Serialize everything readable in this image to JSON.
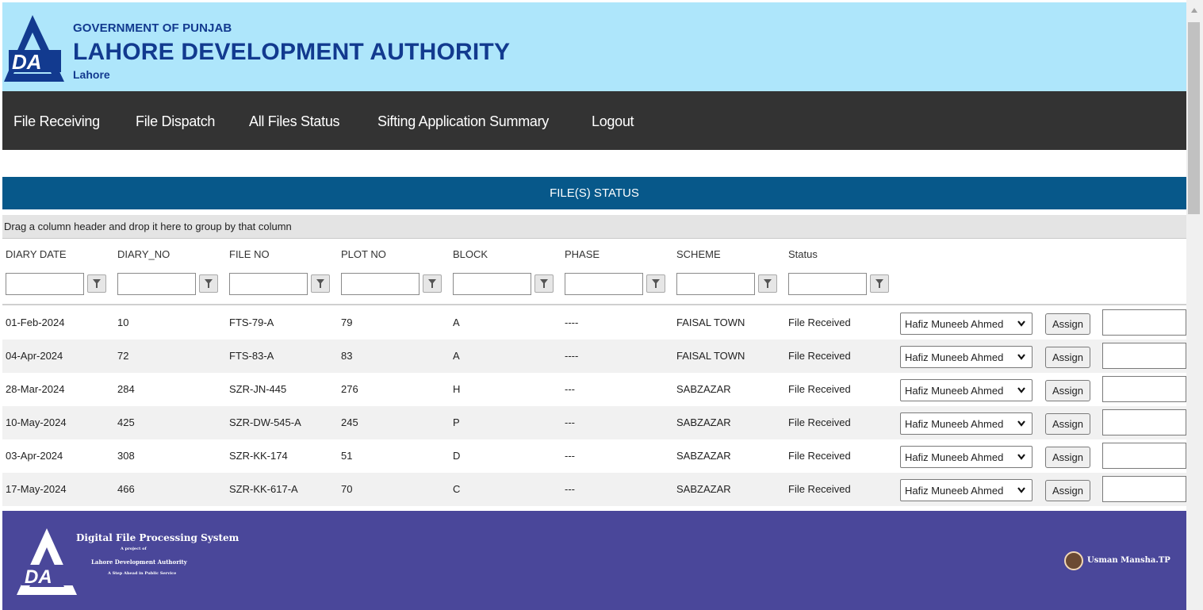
{
  "header": {
    "government": "GOVERNMENT OF PUNJAB",
    "authority": "LAHORE DEVELOPMENT AUTHORITY",
    "city": "Lahore",
    "logo_text": "DA"
  },
  "nav": {
    "items": [
      "File Receiving",
      "File Dispatch",
      "All Files Status",
      "Sifting Application Summary",
      "Logout"
    ]
  },
  "page": {
    "section_title": "FILE(S) STATUS",
    "group_panel_hint": "Drag a column header and drop it here to group by that column"
  },
  "grid": {
    "columns": [
      "DIARY DATE",
      "DIARY_NO",
      "FILE NO",
      "PLOT NO",
      "BLOCK",
      "PHASE",
      "SCHEME",
      "Status"
    ],
    "assign_label": "Assign",
    "rows": [
      {
        "diary_date": "01-Feb-2024",
        "diary_no": "10",
        "file_no": "FTS-79-A",
        "plot_no": "79",
        "block": "A",
        "phase": "----",
        "scheme": "FAISAL TOWN",
        "status": "File Received",
        "assignee": "Hafiz Muneeb Ahmed"
      },
      {
        "diary_date": "04-Apr-2024",
        "diary_no": "72",
        "file_no": "FTS-83-A",
        "plot_no": "83",
        "block": "A",
        "phase": "----",
        "scheme": "FAISAL TOWN",
        "status": "File Received",
        "assignee": "Hafiz Muneeb Ahmed"
      },
      {
        "diary_date": "28-Mar-2024",
        "diary_no": "284",
        "file_no": "SZR-JN-445",
        "plot_no": "276",
        "block": "H",
        "phase": "---",
        "scheme": "SABZAZAR",
        "status": "File Received",
        "assignee": "Hafiz Muneeb Ahmed"
      },
      {
        "diary_date": "10-May-2024",
        "diary_no": "425",
        "file_no": "SZR-DW-545-A",
        "plot_no": "245",
        "block": "P",
        "phase": "---",
        "scheme": "SABZAZAR",
        "status": "File Received",
        "assignee": "Hafiz Muneeb Ahmed"
      },
      {
        "diary_date": "03-Apr-2024",
        "diary_no": "308",
        "file_no": "SZR-KK-174",
        "plot_no": "51",
        "block": "D",
        "phase": "---",
        "scheme": "SABZAZAR",
        "status": "File Received",
        "assignee": "Hafiz Muneeb Ahmed"
      },
      {
        "diary_date": "17-May-2024",
        "diary_no": "466",
        "file_no": "SZR-KK-617-A",
        "plot_no": "70",
        "block": "C",
        "phase": "---",
        "scheme": "SABZAZAR",
        "status": "File Received",
        "assignee": "Hafiz Muneeb Ahmed"
      }
    ]
  },
  "footer": {
    "system_name": "Digital File Processing System",
    "project_of": "A project of",
    "authority": "Lahore Development Authority",
    "tagline": "A Step Ahead in Public Service",
    "user": "Usman Mansha.TP"
  },
  "colors": {
    "header_bg": "#aee6fb",
    "brand_blue": "#123a8f",
    "nav_bg": "#333333",
    "status_bar": "#07588a",
    "footer_bg": "#4a479a"
  },
  "icons": {
    "filter": "filter-funnel-icon",
    "dropdown": "chevron-down-icon",
    "avatar": "user-avatar-icon"
  }
}
